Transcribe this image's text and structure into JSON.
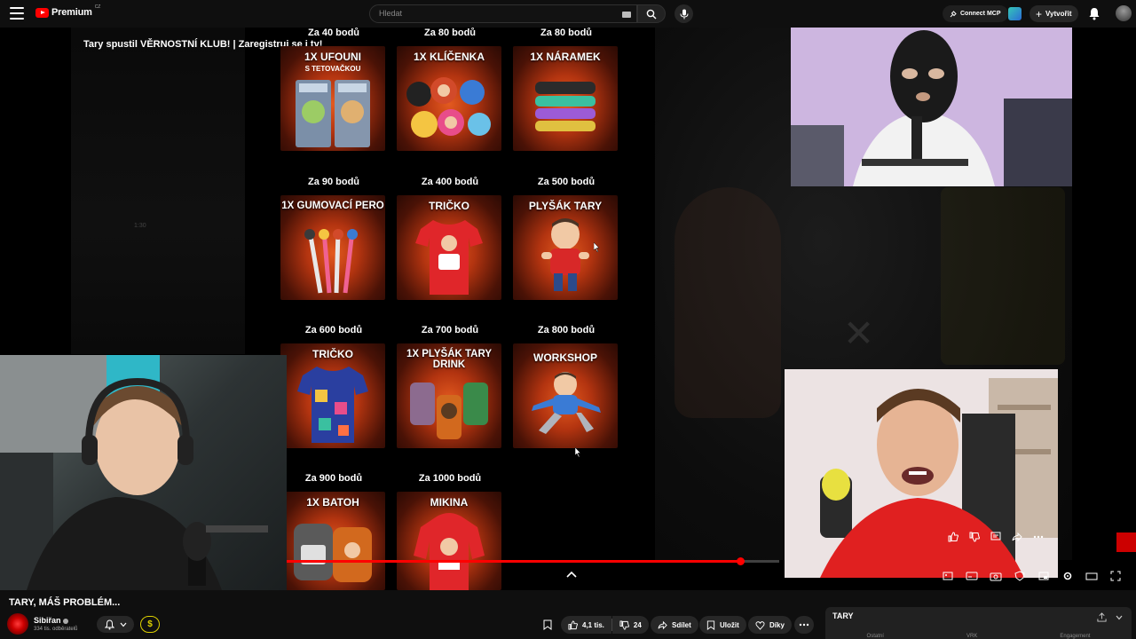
{
  "topbar": {
    "logo_text": "Premium",
    "logo_region": "CZ",
    "search_placeholder": "Hledat",
    "connect_label": "Connect MCP",
    "create_label": "Vytvořit"
  },
  "player": {
    "ticker": "Tary spustil VĚRNOSTNÍ KLUB! | Zaregistruj se i ty!",
    "small_time": "1:30",
    "progress_fraction": 0.92,
    "rewards": [
      {
        "price": "Za 40 bodů",
        "title": "1X UFOUNI",
        "sub": "S TETOVAČKOU"
      },
      {
        "price": "Za 80 bodů",
        "title": "1X KLÍČENKA",
        "sub": ""
      },
      {
        "price": "Za 80 bodů",
        "title": "1X NÁRAMEK",
        "sub": ""
      },
      {
        "price": "Za 90 bodů",
        "title": "1X GUMOVACÍ PERO",
        "sub": ""
      },
      {
        "price": "Za 400 bodů",
        "title": "TRIČKO",
        "sub": ""
      },
      {
        "price": "Za 500 bodů",
        "title": "PLYŠÁK TARY",
        "sub": ""
      },
      {
        "price": "Za 600 bodů",
        "title": "TRIČKO",
        "sub": ""
      },
      {
        "price": "Za 700 bodů",
        "title": "1X PLYŠÁK TARY DRINK",
        "sub": ""
      },
      {
        "price": "Za 800 bodů",
        "title": "WORKSHOP",
        "sub": ""
      },
      {
        "price": "Za 900 bodů",
        "title": "1X BATOH",
        "sub": ""
      },
      {
        "price": "Za 1000 bodů",
        "title": "MIKINA",
        "sub": ""
      }
    ]
  },
  "video": {
    "title": "TARY, MÁŠ PROBLÉM...",
    "channel": "Sibiřan",
    "subscribers": "334 tis. odběratelů",
    "join_symbol": "$",
    "likes": "4,1 tis.",
    "dislikes": "24",
    "share_label": "Sdílet",
    "save_label": "Uložit",
    "thanks_label": "Díky"
  },
  "side_panel": {
    "logo": "TARY",
    "tabs": [
      "Ostatní",
      "VRK",
      "Engagement"
    ]
  }
}
